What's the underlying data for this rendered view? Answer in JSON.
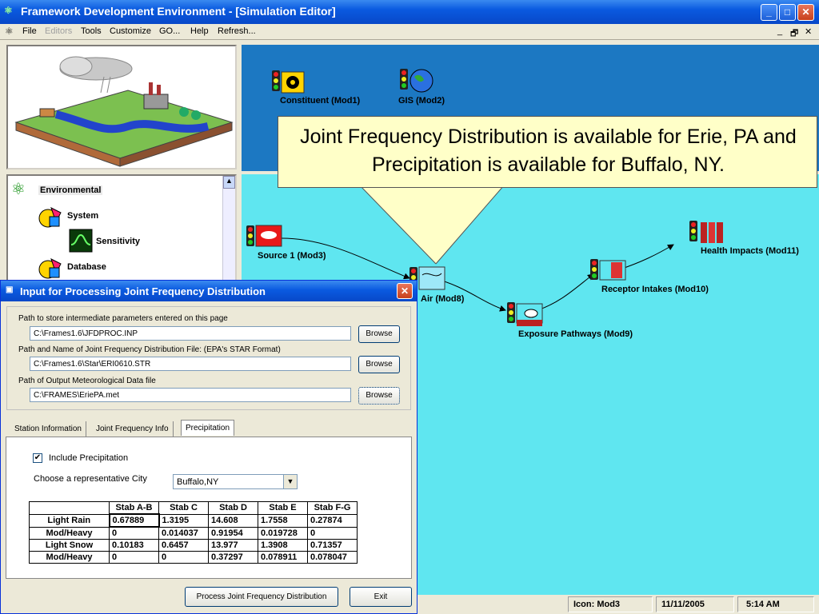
{
  "main_window": {
    "title": "Framework Development Environment - [Simulation Editor]",
    "menu": [
      "File",
      "Editors",
      "Tools",
      "Customize",
      "GO...",
      "Help",
      "Refresh..."
    ],
    "menu_disabled": [
      "Editors"
    ]
  },
  "tree": {
    "items": [
      "Environmental",
      "System",
      "Sensitivity",
      "Database"
    ]
  },
  "canvas": {
    "top_nodes": [
      {
        "label": "Constituent (Mod1)"
      },
      {
        "label": "GIS (Mod2)"
      }
    ],
    "nodes": [
      {
        "label": "Source 1 (Mod3)"
      },
      {
        "label": "Air (Mod8)"
      },
      {
        "label": "Exposure Pathways (Mod9)"
      },
      {
        "label": "Receptor Intakes (Mod10)"
      },
      {
        "label": "Health Impacts (Mod11)"
      }
    ]
  },
  "callout": {
    "text": "Joint Frequency Distribution is available for Erie, PA and Precipitation is available for Buffalo, NY."
  },
  "status": {
    "icon": "Icon: Mod3",
    "date": "11/11/2005",
    "time": "5:14 AM"
  },
  "dialog": {
    "title": "Input for Processing Joint Frequency Distribution",
    "path1_label": "Path to store intermediate parameters entered on this page",
    "path1_value": "C:\\Frames1.6\\JFDPROC.INP",
    "path2_label": "Path and Name of Joint Frequency Distribution File: (EPA's STAR Format)",
    "path2_value": "C:\\Frames1.6\\Star\\ERI0610.STR",
    "path3_label": "Path of Output Meteorological Data file",
    "path3_value": "C:\\FRAMES\\EriePA.met",
    "browse_label": "Browse",
    "tabs": [
      "Station Information",
      "Joint Frequency Info",
      "Precipitation"
    ],
    "active_tab": "Precipitation",
    "include_precip_label": "Include Precipitation",
    "include_precip_checked": true,
    "city_label": "Choose a representative City",
    "city_value": "Buffalo,NY",
    "table": {
      "columns": [
        "",
        "Stab A-B",
        "Stab C",
        "Stab D",
        "Stab E",
        "Stab F-G"
      ],
      "rows": [
        {
          "label": "Light Rain",
          "values": [
            "0.67889",
            "1.3195",
            "14.608",
            "1.7558",
            "0.27874"
          ]
        },
        {
          "label": "Mod/Heavy",
          "values": [
            "0",
            "0.014037",
            "0.91954",
            "0.019728",
            "0"
          ]
        },
        {
          "label": "Light Snow",
          "values": [
            "0.10183",
            "0.6457",
            "13.977",
            "1.3908",
            "0.71357"
          ]
        },
        {
          "label": "Mod/Heavy",
          "values": [
            "0",
            "0",
            "0.37297",
            "0.078911",
            "0.078047"
          ]
        }
      ]
    },
    "process_label": "Process Joint Frequency Distribution",
    "exit_label": "Exit"
  },
  "colors": {
    "canvas_top": "#1c78c2",
    "canvas_bottom": "#5fe6f0",
    "callout": "#ffffc8",
    "titlebar": "#0a5ae0"
  }
}
